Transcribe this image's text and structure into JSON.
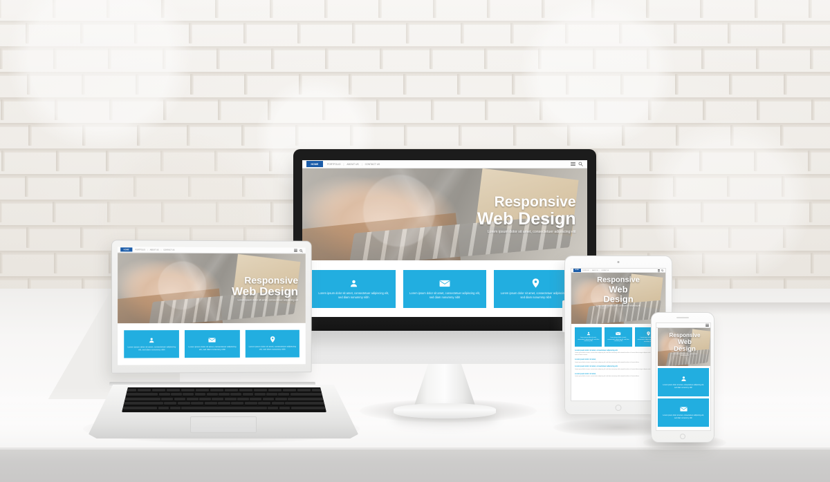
{
  "scene": {
    "title": "Responsive Web Design — multi-device mockup",
    "background": "white brick wall",
    "surface": "white desk"
  },
  "colors": {
    "accent_blue": "#22aee0",
    "nav_active_blue": "#1b5ca8",
    "wall": "#f0eeea",
    "desk": "#f7f6f5",
    "desk_edge": "#cdcccb",
    "bezel_black": "#1c1c1c",
    "device_silver": "#f4f4f3"
  },
  "website": {
    "nav": {
      "home_label": "HOME",
      "links": [
        "PORTFOLIO",
        "ABOUT US",
        "CONTACT US"
      ],
      "separator": "|",
      "icons": [
        "menu-icon",
        "search-icon"
      ]
    },
    "hero": {
      "line1": "Responsive",
      "line2": "Web Design",
      "subtitle": "Lorem ipsum dolor sit amet, consectetuer adipiscing elit",
      "photo_alt": "hands typing on a laptop keyboard"
    },
    "cards": [
      {
        "icon": "user-icon",
        "text": "Lorem ipsum dolor sit amet, consectetuer adipiscing elit, sed diam nonummy nibh"
      },
      {
        "icon": "envelope-icon",
        "text": "Lorem ipsum dolor sit amet, consectetuer adipiscing elit, sed diam nonummy nibh"
      },
      {
        "icon": "location-pin-icon",
        "text": "Lorem ipsum dolor sit amet, consectetuer adipiscing elit, sed diam nonummy nibh"
      }
    ],
    "articles": [
      {
        "heading": "Lorem ipsum dolor sit amet, consectetuer adipiscing elit.",
        "body": "Lorem ipsum dolor sit amet, consectetuer adipiscing elit, sed diam nonummy nibh euismod tincidunt ut laoreet dolore magna aliquam erat volutpat. Ut wisi enim ad minim veniam."
      },
      {
        "heading": "Lorem ipsum dolor sit amet,",
        "body": "Lorem ipsum dolor sit amet, consectetuer adipiscing elit, sed diam nonummy nibh euismod tincidunt ut laoreet dolore."
      },
      {
        "heading": "Lorem ipsum dolor sit amet, consectetuer adipiscing elit.",
        "body": "Lorem ipsum dolor sit amet, consectetuer adipiscing elit, sed diam nonummy nibh euismod tincidunt ut laoreet dolore magna aliquam erat volutpat."
      },
      {
        "heading": "Lorem ipsum dolor sit amet,",
        "body": "Lorem ipsum dolor sit amet, consectetuer adipiscing elit, sed diam nonummy nibh euismod tincidunt ut laoreet dolore."
      }
    ]
  },
  "devices": [
    {
      "name": "desktop-monitor",
      "label": "Desktop monitor"
    },
    {
      "name": "laptop",
      "label": "Laptop"
    },
    {
      "name": "tablet",
      "label": "Tablet"
    },
    {
      "name": "phone",
      "label": "Smartphone"
    }
  ]
}
